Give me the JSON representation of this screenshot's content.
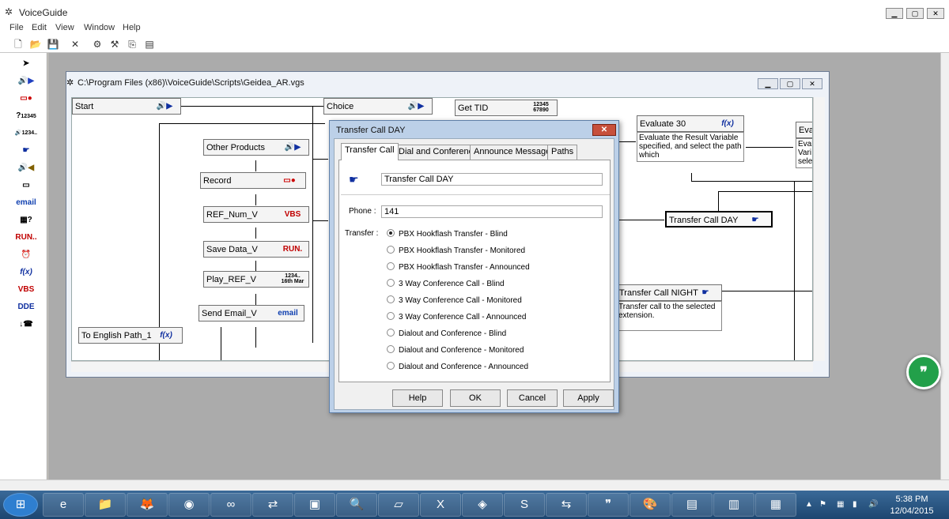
{
  "app": {
    "title": "VoiceGuide",
    "menu": [
      "File",
      "Edit",
      "View",
      "Window",
      "Help"
    ]
  },
  "toolbar": [
    "new-file-icon",
    "open-folder-icon",
    "save-icon",
    "delete-icon",
    "settings-icon",
    "tools-icon",
    "copy-icon",
    "view-icon"
  ],
  "palette": {
    "items": [
      "pointer-icon",
      "play-icon",
      "record-icon",
      "digits-icon",
      "say-number-icon",
      "transfer-icon",
      "announce-icon",
      "voicemail-icon",
      "email-icon",
      "query-icon",
      "run-icon",
      "time-icon",
      "function-icon",
      "vbs-icon",
      "dde-icon",
      "hangup-icon"
    ],
    "labels": {
      "email": "email",
      "run": "RUN..",
      "func": "f(x)",
      "vbs": "VBS",
      "dde": "DDE"
    }
  },
  "child": {
    "title": "C:\\Program Files (x86)\\VoiceGuide\\Scripts\\Geidea_AR.vgs",
    "nodes": {
      "start": "Start",
      "choice": "Choice",
      "get_tid": "Get TID",
      "other_products": "Other Products",
      "record": "Record",
      "ref_num": "REF_Num_V",
      "save_data": "Save Data_V",
      "play_ref": "Play_REF_V",
      "send_email": "Send Email_V",
      "to_english": "To  English Path_1",
      "evaluate30": "Evaluate 30",
      "eval_partial": "Eva",
      "transfer_day": "Transfer Call DAY",
      "transfer_night": "Transfer Call NIGHT"
    },
    "descriptions": {
      "evaluate30": "Evaluate the Result Variable specified, and select the path which",
      "eval_partial": "Eval Vari selec",
      "transfer_night": "Transfer call to the selected extension."
    },
    "icon_text": {
      "digits": "12345 67890",
      "vbs": "VBS",
      "run": "RUN.",
      "saynum": "1234.. 16th Mar",
      "email": "email",
      "func": "f(x)"
    }
  },
  "dialog": {
    "title": "Transfer Call DAY",
    "tabs": [
      "Transfer Call",
      "Dial and Conference",
      "Announce Messages",
      "Paths"
    ],
    "name_value": "Transfer Call DAY",
    "phone_label": "Phone :",
    "phone_value": "141",
    "transfer_label": "Transfer :",
    "options": [
      {
        "label": "PBX Hookflash Transfer - Blind",
        "selected": true
      },
      {
        "label": "PBX Hookflash Transfer - Monitored",
        "selected": false
      },
      {
        "label": "PBX Hookflash Transfer - Announced",
        "selected": false
      },
      {
        "label": "3 Way Conference Call - Blind",
        "selected": false
      },
      {
        "label": "3 Way Conference Call - Monitored",
        "selected": false
      },
      {
        "label": "3 Way Conference Call - Announced",
        "selected": false
      },
      {
        "label": "Dialout and Conference - Blind",
        "selected": false
      },
      {
        "label": "Dialout and Conference - Monitored",
        "selected": false
      },
      {
        "label": "Dialout and Conference - Announced",
        "selected": false
      }
    ],
    "buttons": {
      "help": "Help",
      "ok": "OK",
      "cancel": "Cancel",
      "apply": "Apply"
    }
  },
  "taskbar": {
    "apps": [
      "start-orb-icon",
      "ie-icon",
      "explorer-icon",
      "firefox-icon",
      "chrome-icon",
      "app-icon",
      "network-icon",
      "voiceguide-icon",
      "search-icon",
      "notes-icon",
      "xamarin-icon",
      "box-icon",
      "skype-icon",
      "teamviewer-icon",
      "hangouts-icon",
      "paint-icon",
      "remote-icon",
      "terminal-icon",
      "office-icon"
    ],
    "time": "5:38 PM",
    "date": "12/04/2015"
  },
  "badge": "❞"
}
